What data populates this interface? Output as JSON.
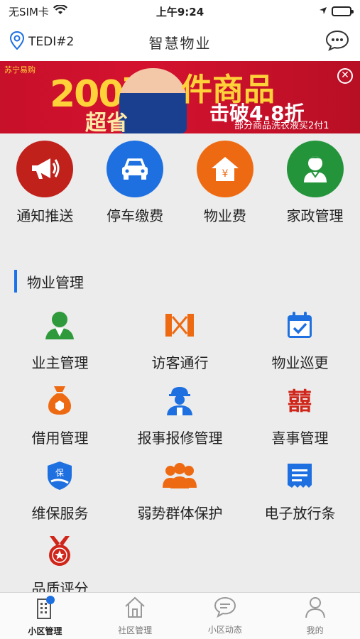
{
  "status": {
    "carrier": "无SIM卡",
    "time": "上午9:24"
  },
  "nav": {
    "location": "TEDI#2",
    "title": "智慧物业"
  },
  "banner": {
    "logo": "苏宁易购",
    "headline_num": "200万",
    "headline_text": "件商品",
    "sub_left": "超省",
    "sub_right": "击破4.8折",
    "sub_small": "部分商品洗衣液买2付1",
    "close": "✕"
  },
  "quick": [
    {
      "label": "通知推送",
      "color": "#c0211a",
      "icon": "megaphone-icon"
    },
    {
      "label": "停车缴费",
      "color": "#1e6fe0",
      "icon": "car-icon"
    },
    {
      "label": "物业费",
      "color": "#ee6a12",
      "icon": "house-yen-icon"
    },
    {
      "label": "家政管理",
      "color": "#24943b",
      "icon": "housekeeper-icon"
    }
  ],
  "section": {
    "title": "物业管理"
  },
  "grid": [
    {
      "label": "业主管理",
      "icon": "owner-icon",
      "color": "#2e9a3c"
    },
    {
      "label": "访客通行",
      "icon": "gate-icon",
      "color": "#ee6a12"
    },
    {
      "label": "物业巡更",
      "icon": "calendar-check-icon",
      "color": "#1e6fe0"
    },
    {
      "label": "借用管理",
      "icon": "money-bag-icon",
      "color": "#ee6a12"
    },
    {
      "label": "报事报修管理",
      "icon": "worker-icon",
      "color": "#1e6fe0"
    },
    {
      "label": "喜事管理",
      "icon": "double-happiness-icon",
      "color": "#d0261a"
    },
    {
      "label": "维保服务",
      "icon": "shield-icon",
      "color": "#1e6fe0"
    },
    {
      "label": "弱势群体保护",
      "icon": "group-icon",
      "color": "#ee6a12"
    },
    {
      "label": "电子放行条",
      "icon": "pass-icon",
      "color": "#1e6fe0"
    },
    {
      "label": "品质评分",
      "icon": "medal-icon",
      "color": "#d0261a"
    }
  ],
  "tabs": [
    {
      "label": "小区管理",
      "icon": "building-icon"
    },
    {
      "label": "社区管理",
      "icon": "home-icon"
    },
    {
      "label": "小区动态",
      "icon": "chat-icon"
    },
    {
      "label": "我的",
      "icon": "profile-icon"
    }
  ]
}
